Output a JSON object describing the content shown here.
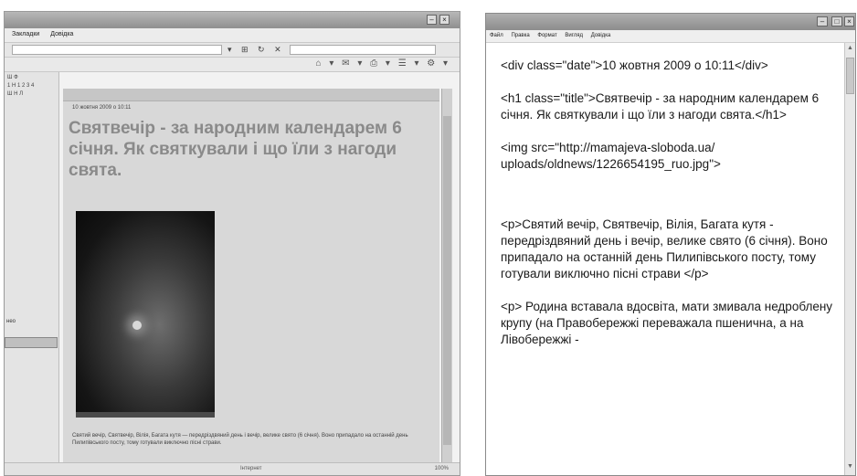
{
  "left_window": {
    "menu": [
      "Закладки",
      "Довідка"
    ],
    "left_panel_rows": [
      "Ш Ф",
      "1 Н 1 2 3 4",
      "Ш Н Л"
    ],
    "panel_label": "нео",
    "content": {
      "date": "10 жовтня 2009 о 10:11",
      "title": "Святвечір - за народним календарем 6 січня. Як святкували і що їли з нагоди свята.",
      "caption": "Святий вечір, Святвечір, Вілія, Багата кутя — передріздвяний день і вечір, велике свято (6 січня). Воно припадало на останній день Пилипівського посту, тому готували виключно пісні страви."
    },
    "status": {
      "middle": "Інтернет",
      "zoom": "100%"
    }
  },
  "right_window": {
    "menu": [
      "Файл",
      "Правка",
      "Формат",
      "Вигляд",
      "Довідка"
    ],
    "lines": [
      "<div class=\"date\">10 жовтня 2009 о 10:11</div>",
      "<h1 class=\"title\">Святвечір - за народним календарем 6 січня. Як святкували і що їли з нагоди свята.</h1>",
      "<img src=\"http://mamajeva-sloboda.ua/ uploads/oldnews/1226654195_ruo.jpg\">",
      "<p>Святий вечір, Святвечір, Вілія, Багата кутя - передріздвяний день і вечір, велике свято (6 січня). Воно припадало на останній день Пилипівського посту, тому готували виключно пісні страви </p>",
      "<p> Родина вставала вдосвіта, мати змивала недроблену крупу (на Правобережжі переважала пшенична, а на Лівобережжі -"
    ]
  }
}
